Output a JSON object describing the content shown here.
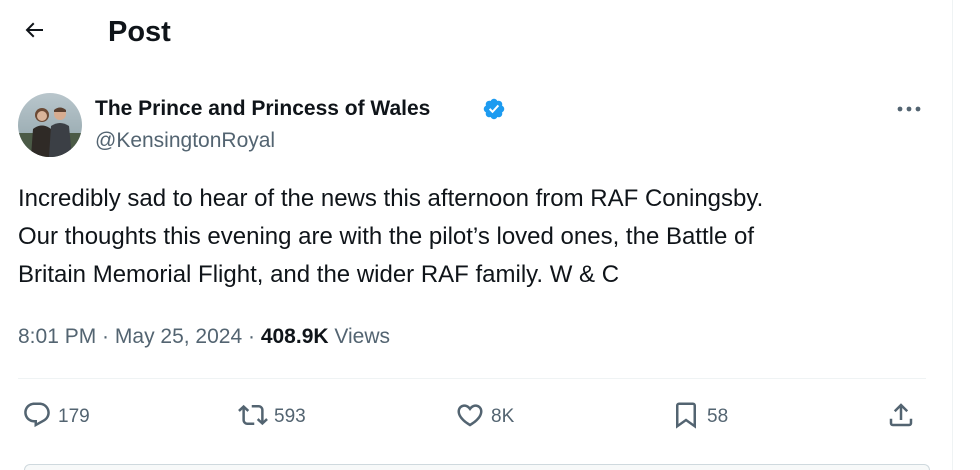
{
  "header": {
    "title": "Post",
    "back_icon": "arrow-left-icon"
  },
  "author": {
    "display_name": "The Prince and Princess of Wales",
    "handle": "@KensingtonRoyal",
    "verified": true,
    "verified_color": "#1d9bf0"
  },
  "post": {
    "text_lines": [
      "Incredibly sad to hear of the news this afternoon from RAF Coningsby.",
      "Our thoughts this evening are with the pilot’s loved ones, the Battle of",
      "Britain Memorial Flight, and the wider RAF family. W & C"
    ]
  },
  "meta": {
    "time": "8:01 PM",
    "separator": " · ",
    "date": "May 25, 2024",
    "views_count": "408.9K",
    "views_label": " Views"
  },
  "actions": {
    "reply": {
      "icon": "reply-icon",
      "count": "179"
    },
    "repost": {
      "icon": "repost-icon",
      "count": "593"
    },
    "like": {
      "icon": "heart-icon",
      "count": "8K"
    },
    "bookmark": {
      "icon": "bookmark-icon",
      "count": "58"
    },
    "share": {
      "icon": "share-icon"
    }
  },
  "colors": {
    "text_primary": "#0f1419",
    "text_secondary": "#536471",
    "accent": "#1d9bf0",
    "divider": "#eff3f4"
  }
}
